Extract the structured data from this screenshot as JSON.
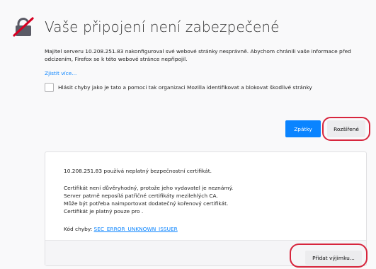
{
  "error_page": {
    "title": "Vaše připojení není zabezpečené",
    "short_description": "Majitel serveru 10.208.251.83 nakonfiguroval své webové stránky nesprávně. Abychom chránili vaše informace před odcizením, Firefox se k této webové stránce nepřipojil.",
    "learn_more_label": "Zjistit více...",
    "report_checkbox_label": "Hlásit chyby jako je tato a pomoci tak organizaci Mozilla identifikovat a blokovat škodlivé stránky",
    "report_checked": false
  },
  "buttons": {
    "back_label": "Zpátky",
    "advanced_label": "Rozšířené",
    "add_exception_label": "Přidat výjimku..."
  },
  "advanced_panel": {
    "host_message": "10.208.251.83 používá neplatný bezpečnostní certifikát.",
    "details": [
      "Certifikát není důvěryhodný, protože jeho vydavatel je neznámý.",
      "Server patrně neposílá patřičné certifikáty mezilehlých CA.",
      "Může být potřeba naimportovat dodatečný kořenový certifikát.",
      "Certifikát je platný pouze pro ."
    ],
    "error_code_label": "Kód chyby:",
    "error_code": "SEC_ERROR_UNKNOWN_ISSUER"
  },
  "icons": {
    "warning": "broken-lock-icon"
  },
  "colors": {
    "accent": "#0a84ff",
    "annotation_ring": "#d7263d",
    "background": "#f9f9fa"
  }
}
